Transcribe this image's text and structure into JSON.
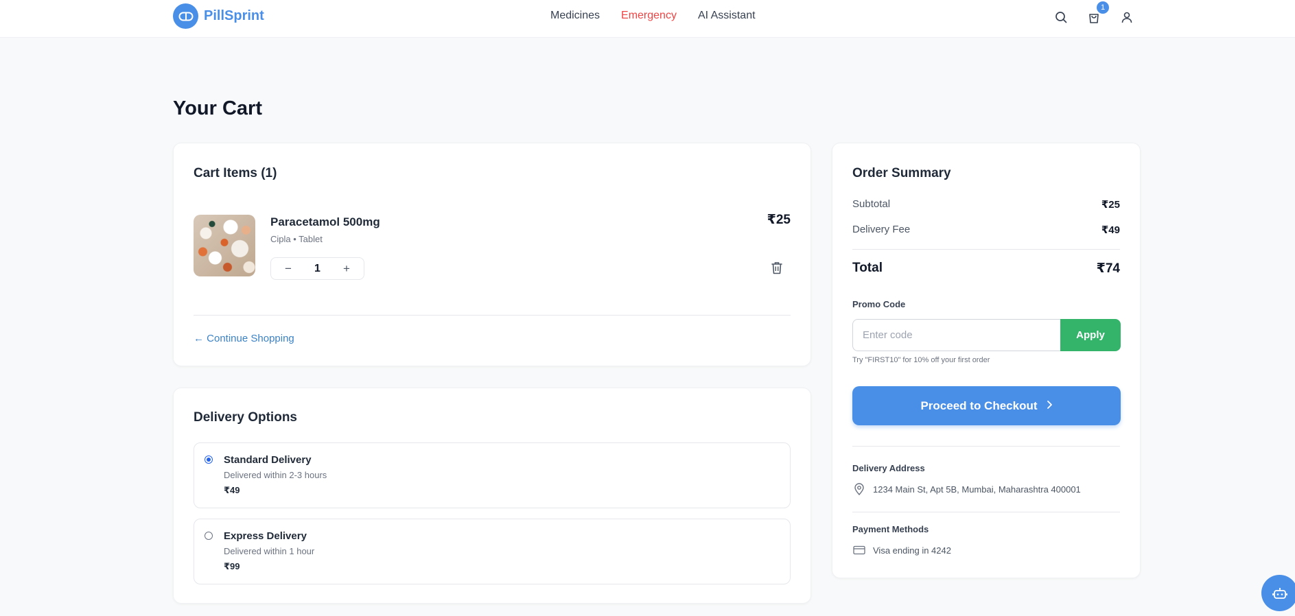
{
  "header": {
    "brand": "PillSprint",
    "nav": [
      {
        "label": "Medicines"
      },
      {
        "label": "Emergency"
      },
      {
        "label": "AI Assistant"
      }
    ],
    "cart_count": "1"
  },
  "page": {
    "title": "Your Cart"
  },
  "cart": {
    "title": "Cart Items (1)",
    "items": [
      {
        "name": "Paracetamol 500mg",
        "meta": "Cipla • Tablet",
        "price": "₹25",
        "quantity": "1",
        "decrement": "−",
        "increment": "+"
      }
    ],
    "continue_label": "← Continue Shopping"
  },
  "delivery": {
    "title": "Delivery Options",
    "options": [
      {
        "name": "Standard Delivery",
        "desc": "Delivered within 2-3 hours",
        "price": "₹49",
        "selected": true
      },
      {
        "name": "Express Delivery",
        "desc": "Delivered within 1 hour",
        "price": "₹99",
        "selected": false
      }
    ]
  },
  "summary": {
    "title": "Order Summary",
    "subtotal_label": "Subtotal",
    "subtotal_value": "₹25",
    "delivery_label": "Delivery Fee",
    "delivery_value": "₹49",
    "total_label": "Total",
    "total_value": "₹74",
    "promo_label": "Promo Code",
    "promo_placeholder": "Enter code",
    "promo_value": "",
    "apply_label": "Apply",
    "promo_hint": "Try \"FIRST10\" for 10% off your first order",
    "checkout_label": "Proceed to Checkout",
    "address_label": "Delivery Address",
    "address_value": "1234 Main St, Apt 5B, Mumbai, Maharashtra 400001",
    "payment_label": "Payment Methods",
    "payment_value": "Visa ending in 4242"
  },
  "colors": {
    "brand": "#4a8fe7",
    "emergency": "#ef4444",
    "apply": "#34b36b"
  }
}
